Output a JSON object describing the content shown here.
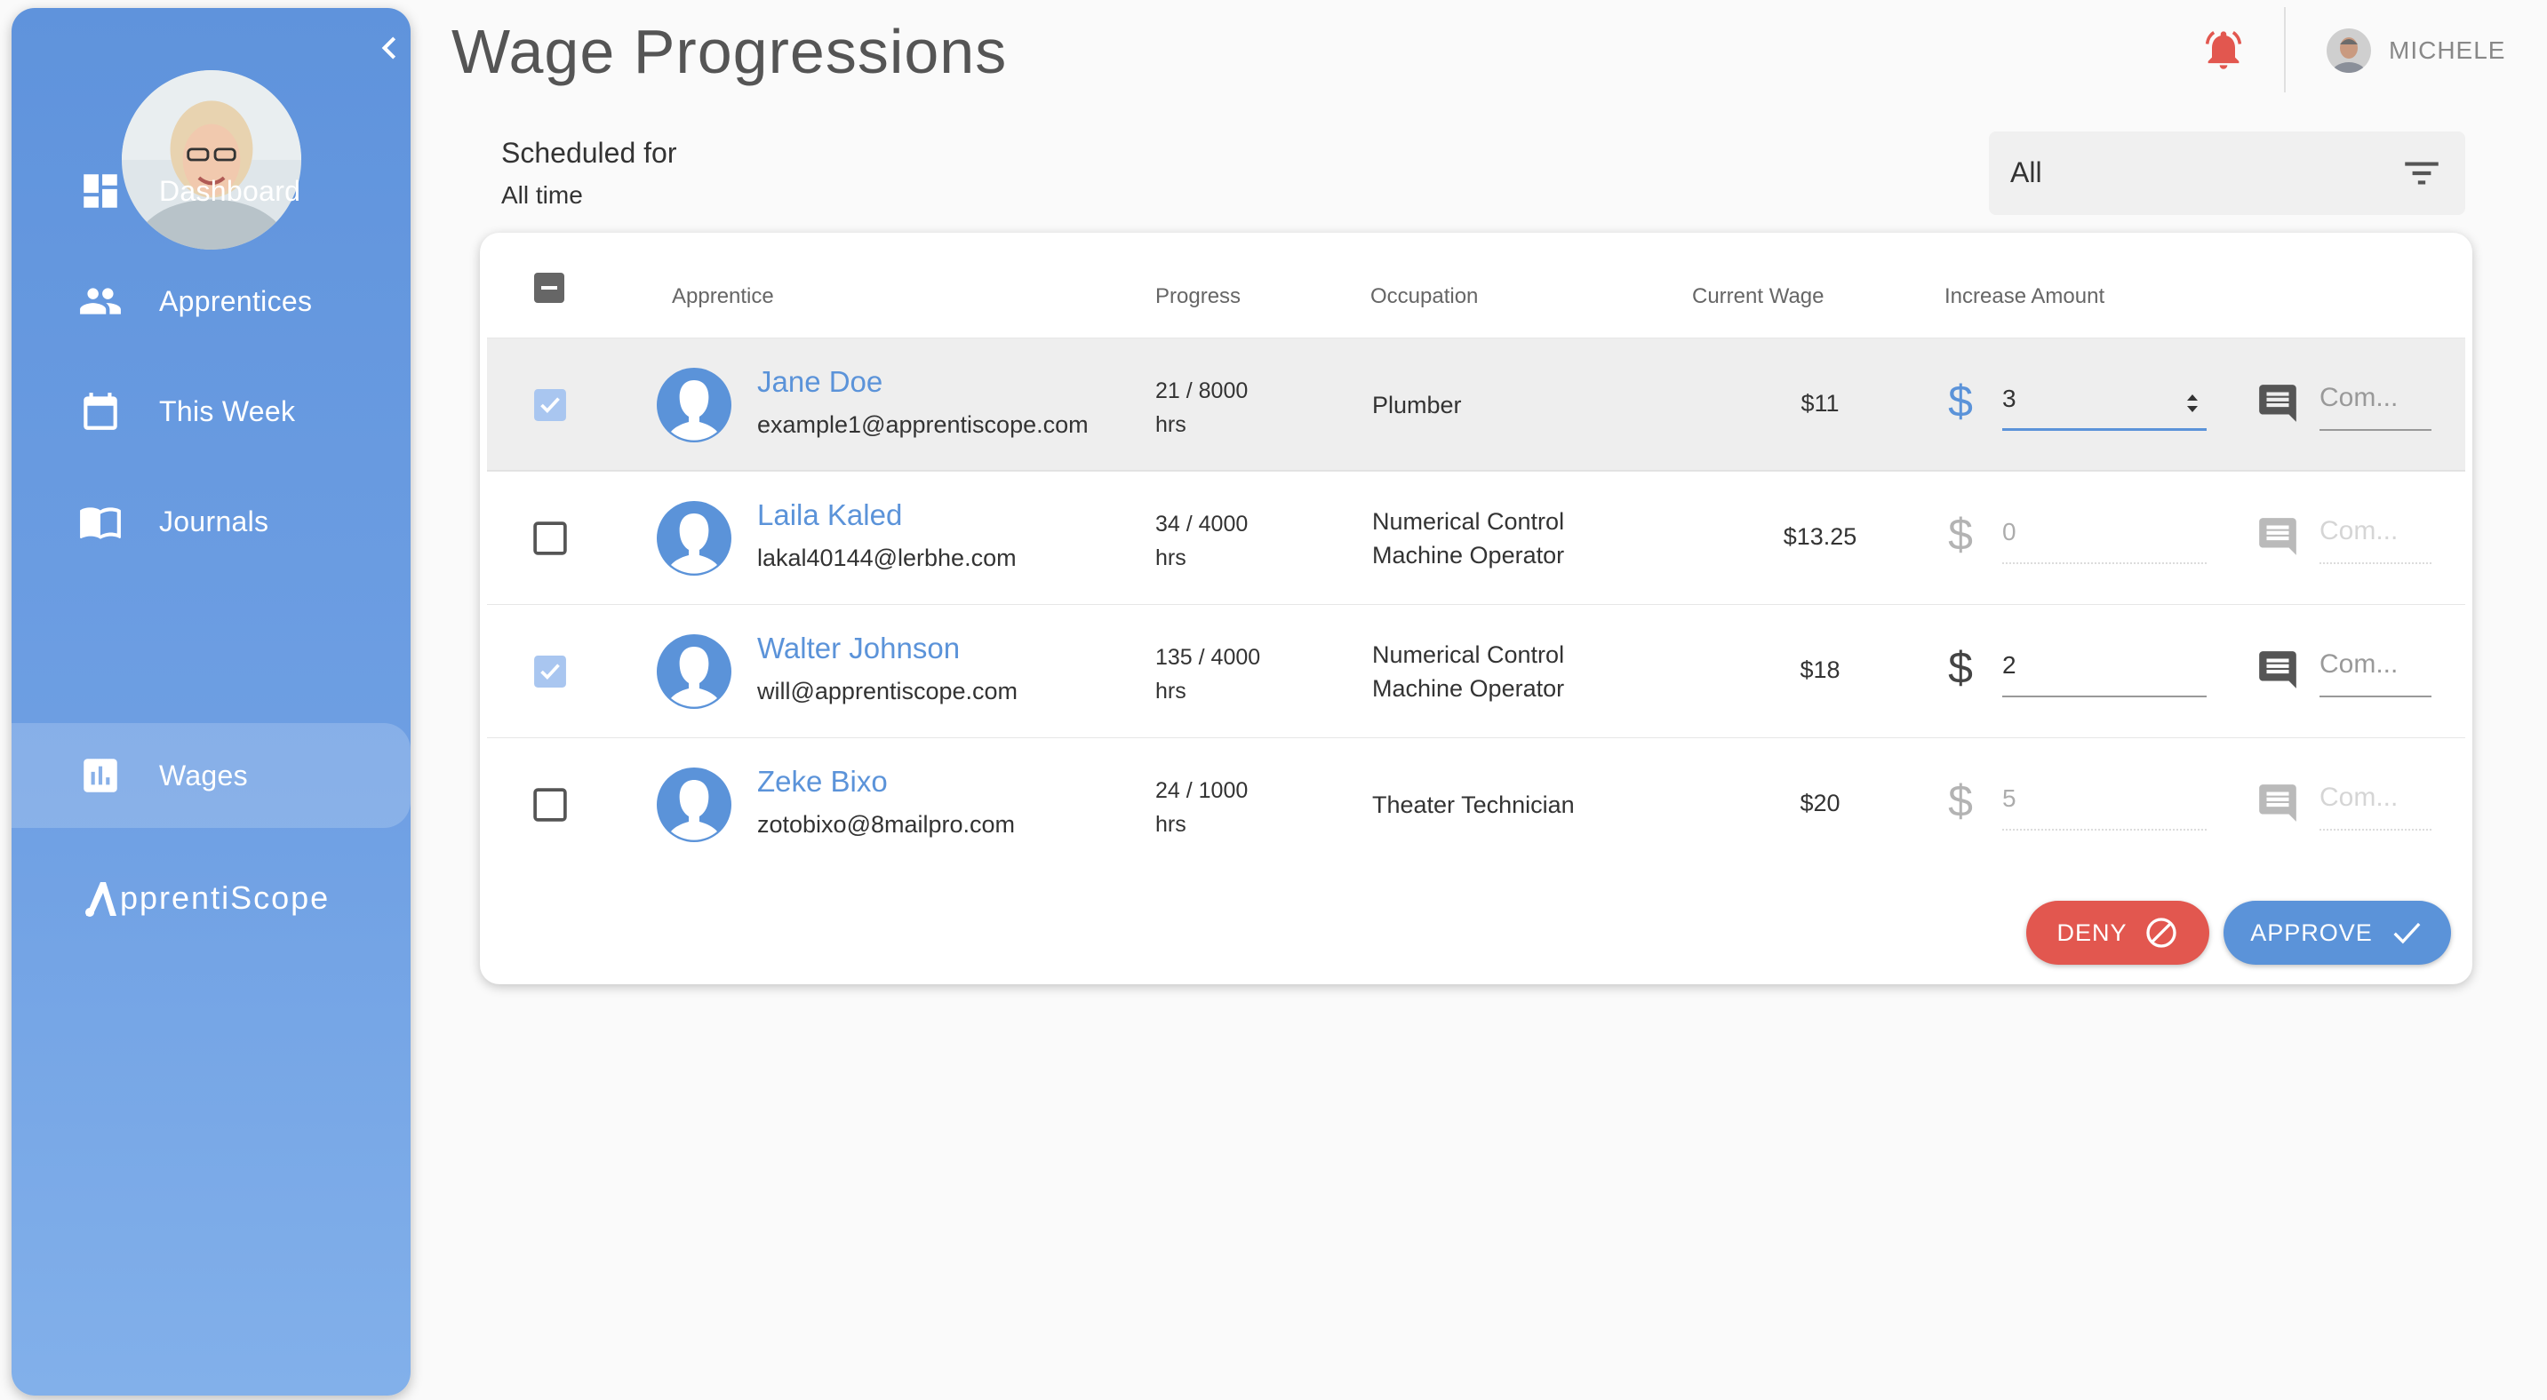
{
  "sidebar": {
    "items": [
      {
        "label": "Dashboard",
        "icon": "dashboard-icon"
      },
      {
        "label": "Apprentices",
        "icon": "people-icon"
      },
      {
        "label": "This Week",
        "icon": "calendar-icon"
      },
      {
        "label": "Journals",
        "icon": "book-icon"
      },
      {
        "label": "Wages",
        "icon": "bar-chart-icon",
        "active": true
      }
    ],
    "brand": "pprentiScope"
  },
  "header": {
    "title": "Wage Progressions",
    "user": "MICHELE"
  },
  "schedule": {
    "label": "Scheduled for",
    "value": "All time",
    "filter_value": "All"
  },
  "table": {
    "columns": {
      "apprentice": "Apprentice",
      "progress": "Progress",
      "occupation": "Occupation",
      "current_wage": "Current Wage",
      "increase_amount": "Increase Amount"
    },
    "comment_placeholder": "Com...",
    "rows": [
      {
        "name": "Jane Doe",
        "email": "example1@apprentiscope.com",
        "progress": "21 / 8000",
        "progress_unit": "hrs",
        "occupation_1": "Plumber",
        "occupation_2": "",
        "wage": "$11",
        "amount": "3",
        "checked": true
      },
      {
        "name": "Laila Kaled",
        "email": "lakal40144@lerbhe.com",
        "progress": "34 / 4000",
        "progress_unit": "hrs",
        "occupation_1": "Numerical Control",
        "occupation_2": "Machine Operator",
        "wage": "$13.25",
        "amount": "0",
        "checked": false
      },
      {
        "name": "Walter Johnson",
        "email": "will@apprentiscope.com",
        "progress": "135 / 4000",
        "progress_unit": "hrs",
        "occupation_1": "Numerical Control",
        "occupation_2": "Machine Operator",
        "wage": "$18",
        "amount": "2",
        "checked": true
      },
      {
        "name": "Zeke Bixo",
        "email": "zotobixo@8mailpro.com",
        "progress": "24 / 1000",
        "progress_unit": "hrs",
        "occupation_1": "Theater Technician",
        "occupation_2": "",
        "wage": "$20",
        "amount": "5",
        "checked": false
      }
    ]
  },
  "actions": {
    "deny": "DENY",
    "approve": "APPROVE"
  },
  "colors": {
    "accent": "#5b93d9",
    "danger": "#e2574f",
    "bell": "#e2574f"
  }
}
